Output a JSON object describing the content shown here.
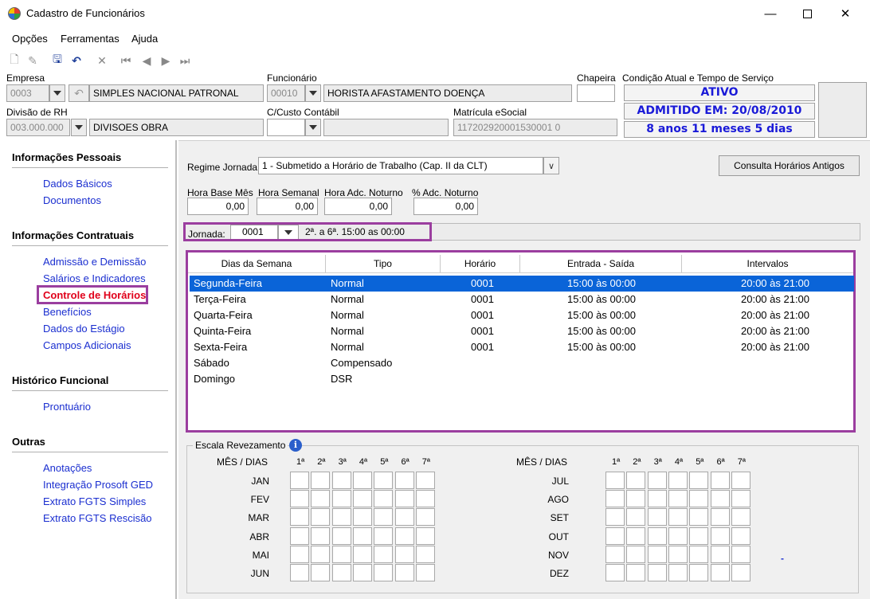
{
  "window": {
    "title": "Cadastro de Funcionários"
  },
  "menu": [
    "Opções",
    "Ferramentas",
    "Ajuda"
  ],
  "header": {
    "empresa_label": "Empresa",
    "empresa_code": "0003",
    "empresa_name": "SIMPLES NACIONAL PATRONAL",
    "funcionario_label": "Funcionário",
    "funcionario_code": "00010",
    "funcionario_name": "HORISTA AFASTAMENTO DOENÇA",
    "chapeira_label": "Chapeira",
    "chapeira_value": "",
    "condicao_label": "Condição Atual e Tempo de Serviço",
    "status": "ATIVO",
    "admitido": "ADMITIDO EM: 20/08/2010",
    "tempo": "8 anos 11 meses 5 dias",
    "divisao_label": "Divisão de RH",
    "divisao_code": "003.000.000",
    "divisao_name": "DIVISOES OBRA",
    "custo_label": "C/Custo Contábil",
    "custo_value": "",
    "matricula_label": "Matrícula eSocial",
    "matricula_value": "117202920001530001 0"
  },
  "sidebar": {
    "pessoais_title": "Informações Pessoais",
    "pessoais": [
      "Dados Básicos",
      "Documentos"
    ],
    "contratuais_title": "Informações Contratuais",
    "contratuais": [
      "Admissão e Demissão",
      "Salários e Indicadores",
      "Controle de Horários",
      "Benefícios",
      "Dados do Estágio",
      "Campos Adicionais"
    ],
    "historico_title": "Histórico Funcional",
    "historico": [
      "Prontuário"
    ],
    "outras_title": "Outras",
    "outras": [
      "Anotações",
      "Integração Prosoft GED",
      "Extrato FGTS Simples",
      "Extrato FGTS Rescisão"
    ]
  },
  "main": {
    "regime_label": "Regime Jornada",
    "regime_value": "1 - Submetido a Horário de Trabalho (Cap. II da CLT)",
    "consulta_button": "Consulta Horários Antigos",
    "hora_base_label": "Hora Base Mês",
    "hora_base": "0,00",
    "hora_semanal_label": "Hora Semanal",
    "hora_semanal": "0,00",
    "hora_adc_label": "Hora Adc. Noturno",
    "hora_adc": "0,00",
    "pct_adc_label": "% Adc. Noturno",
    "pct_adc": "0,00",
    "jornada_label": "Jornada:",
    "jornada_code": "0001",
    "jornada_desc": "2ª. a 6ª. 15:00 as 00:00",
    "columns": [
      "Dias da Semana",
      "Tipo",
      "Horário",
      "Entrada - Saída",
      "Intervalos"
    ],
    "rows": [
      {
        "dia": "Segunda-Feira",
        "tipo": "Normal",
        "horario": "0001",
        "entrada": "15:00 às 00:00",
        "intervalo": "20:00 às 21:00"
      },
      {
        "dia": "Terça-Feira",
        "tipo": "Normal",
        "horario": "0001",
        "entrada": "15:00 às 00:00",
        "intervalo": "20:00 às 21:00"
      },
      {
        "dia": "Quarta-Feira",
        "tipo": "Normal",
        "horario": "0001",
        "entrada": "15:00 às 00:00",
        "intervalo": "20:00 às 21:00"
      },
      {
        "dia": "Quinta-Feira",
        "tipo": "Normal",
        "horario": "0001",
        "entrada": "15:00 às 00:00",
        "intervalo": "20:00 às 21:00"
      },
      {
        "dia": "Sexta-Feira",
        "tipo": "Normal",
        "horario": "0001",
        "entrada": "15:00 às 00:00",
        "intervalo": "20:00 às 21:00"
      },
      {
        "dia": "Sábado",
        "tipo": "Compensado",
        "horario": "",
        "entrada": "",
        "intervalo": ""
      },
      {
        "dia": "Domingo",
        "tipo": "DSR",
        "horario": "",
        "entrada": "",
        "intervalo": ""
      }
    ],
    "escala_title": "Escala Revezamento",
    "mes_dias_label": "MÊS / DIAS",
    "weeks": [
      "1ª",
      "2ª",
      "3ª",
      "4ª",
      "5ª",
      "6ª",
      "7ª"
    ],
    "months_left": [
      "JAN",
      "FEV",
      "MAR",
      "ABR",
      "MAI",
      "JUN"
    ],
    "months_right": [
      "JUL",
      "AGO",
      "SET",
      "OUT",
      "NOV",
      "DEZ"
    ],
    "dash": "-"
  }
}
